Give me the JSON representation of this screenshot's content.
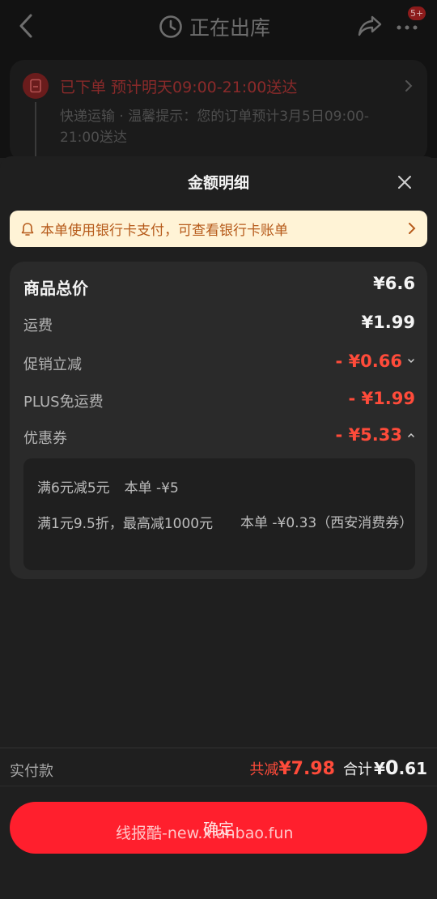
{
  "header": {
    "title": "正在出库",
    "more_badge": "5+"
  },
  "order": {
    "status": "已下单",
    "eta": "预计明天09:00-21:00送达",
    "description": "快递运输 · 温馨提示：您的订单预计3月5日09:00-21:00送达"
  },
  "sheet": {
    "title": "金额明细",
    "notice": "本单使用银行卡支付，可查看银行卡账单"
  },
  "details": {
    "total_label": "商品总价",
    "total_value": "¥6.6",
    "shipping_label": "运费",
    "shipping_value": "¥1.99",
    "promo_label": "促销立减",
    "promo_value": "- ¥0.66",
    "plus_label": "PLUS免运费",
    "plus_value": "- ¥1.99",
    "coupon_label": "优惠券",
    "coupon_value": "- ¥5.33"
  },
  "coupons": {
    "c1_name": "满6元减5元",
    "c1_amount": "本单 -¥5",
    "c2_name": "满1元9.5折，最高减1000元",
    "c2_amount": "本单 -¥0.33（西安消费券）"
  },
  "footer": {
    "pay_label": "实付款",
    "discount_label": "共减",
    "discount_value": "¥7.98",
    "sum_label": "合计",
    "sum_currency": "¥",
    "sum_int": "0",
    "sum_dec": ".61",
    "confirm": "确定",
    "watermark": "线报酷-new.xianbao.fun"
  },
  "colors": {
    "accent_red": "#ff1f2d",
    "discount_red": "#ff4b3a",
    "notice_bg": "#fff3d6",
    "notice_text": "#b65a1a"
  }
}
